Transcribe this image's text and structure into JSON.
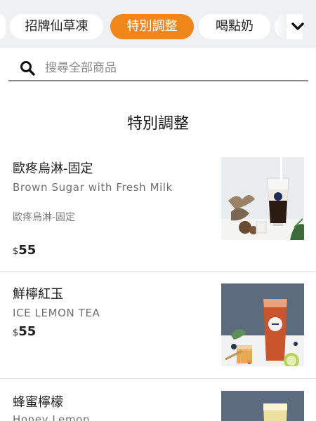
{
  "categories": {
    "tabs": [
      {
        "label": "招牌仙草凍",
        "active": false
      },
      {
        "label": "特別調整",
        "active": true
      },
      {
        "label": "喝點奶",
        "active": false
      }
    ],
    "more_icon": "chevron-down-icon",
    "accent_color": "#f0861a"
  },
  "search": {
    "icon": "search-icon",
    "placeholder": "搜尋全部商品",
    "value": ""
  },
  "section": {
    "title": "特別調整"
  },
  "products": [
    {
      "name": "歐疼烏淋-固定",
      "subtitle": "Brown Sugar with Fresh Milk",
      "description": "歐疼烏淋-固定",
      "currency": "$",
      "price": "55"
    },
    {
      "name": "鮮檸紅玉",
      "subtitle": "ICE LEMON TEA",
      "currency": "$",
      "price": "55"
    },
    {
      "name": "蜂蜜檸檬",
      "subtitle": "Honey  Lemon"
    }
  ]
}
